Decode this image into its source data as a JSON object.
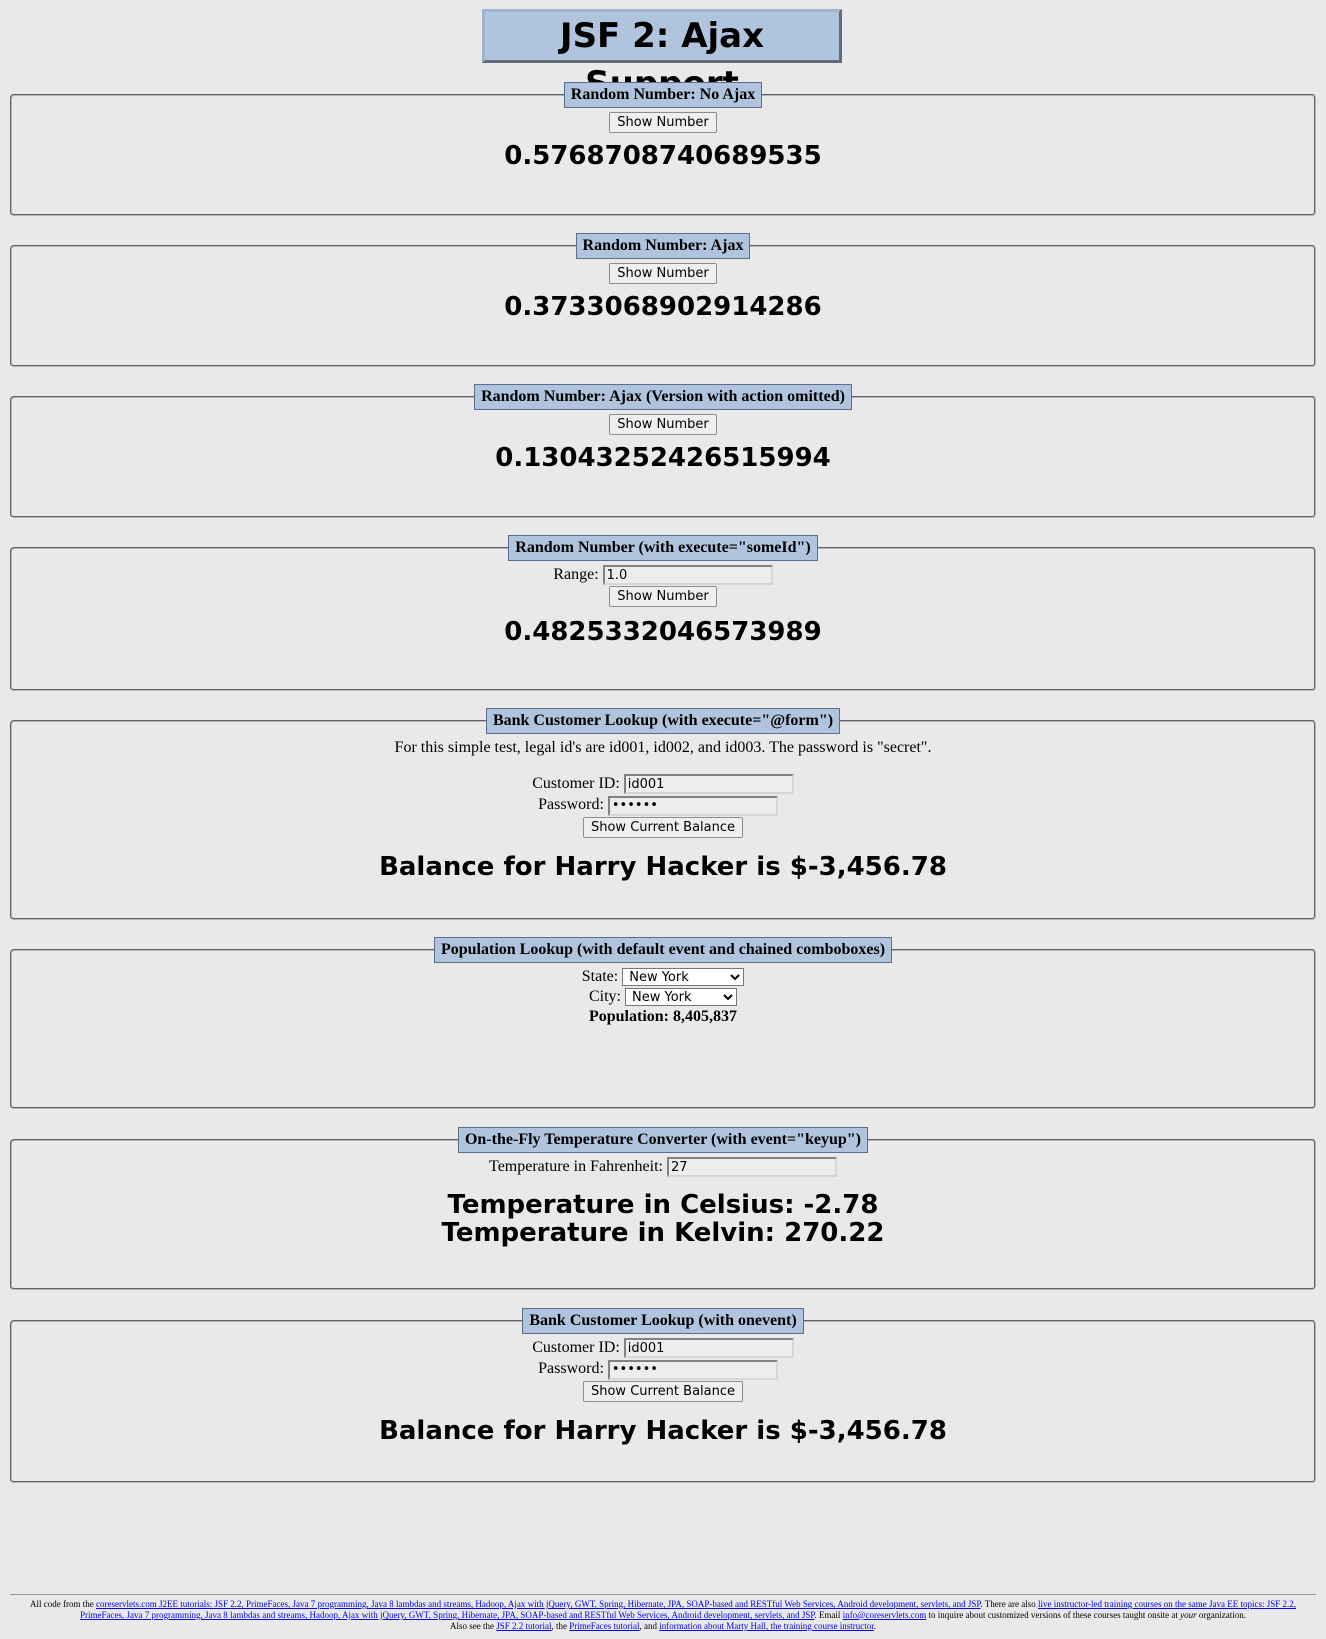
{
  "page_title": "JSF 2: Ajax Support",
  "show_number_label": "Show Number",
  "show_balance_label": "Show Current Balance",
  "sections": {
    "no_ajax": {
      "legend": "Random Number: No Ajax",
      "result": "0.5768708740689535"
    },
    "ajax": {
      "legend": "Random Number: Ajax",
      "result": "0.3733068902914286"
    },
    "ajax_no_action": {
      "legend": "Random Number: Ajax (Version with action omitted)",
      "result": "0.13043252426515994"
    },
    "execute_some_id": {
      "legend": "Random Number (with execute=\"someId\")",
      "range_label": "Range:",
      "range_value": "1.0",
      "result": "0.4825332046573989"
    },
    "bank_form": {
      "legend": "Bank Customer Lookup (with execute=\"@form\")",
      "note": "For this simple test, legal id's are id001, id002, and id003. The password is \"secret\".",
      "customer_id_label": "Customer ID:",
      "customer_id_value": "id001",
      "password_label": "Password:",
      "password_value": "••••••",
      "result": "Balance for Harry Hacker is $-3,456.78"
    },
    "population": {
      "legend": "Population Lookup (with default event and chained comboboxes)",
      "state_label": "State:",
      "state_value": "New York",
      "city_label": "City:",
      "city_value": "New York",
      "population_text": "Population: 8,405,837"
    },
    "temperature": {
      "legend": "On-the-Fly Temperature Converter (with event=\"keyup\")",
      "fahrenheit_label": "Temperature in Fahrenheit:",
      "fahrenheit_value": "27",
      "celsius": "Temperature in Celsius: -2.78",
      "kelvin": "Temperature in Kelvin: 270.22"
    },
    "bank_onevent": {
      "legend": "Bank Customer Lookup (with onevent)",
      "customer_id_label": "Customer ID:",
      "customer_id_value": "id001",
      "password_label": "Password:",
      "password_value": "••••••",
      "result": "Balance for Harry Hacker is $-3,456.78"
    }
  },
  "footer": {
    "t1": "All code from the ",
    "l1": "coreservlets.com J2EE tutorials: JSF 2.2, PrimeFaces, Java 7 programming, Java 8 lambdas and streams, Hadoop, Ajax with jQuery, GWT, Spring, Hibernate, JPA, SOAP-based and RESTful Web Services, Android development, servlets, and JSP",
    "t2": ". There are also ",
    "l2": "live instructor-led training courses on the same Java EE topics: JSF 2.2, PrimeFaces, Java 7 programming, Java 8 lambdas and streams, Hadoop, Ajax with jQuery, GWT, Spring, Hibernate, JPA, SOAP-based and RESTful Web Services, Android development, servlets, and JSP",
    "t3": ". Email ",
    "l3": "info@coreservlets.com",
    "t4": " to inquire about customized versions of these courses taught onsite at ",
    "t4_em": "your",
    "t5": " organization.",
    "t6": "Also see the ",
    "l4": "JSF 2.2 tutorial",
    "t7": ", the ",
    "l5": "PrimeFaces tutorial",
    "t8": ", and ",
    "l6": "information about Marty Hall, the training course instructor",
    "t9": "."
  }
}
